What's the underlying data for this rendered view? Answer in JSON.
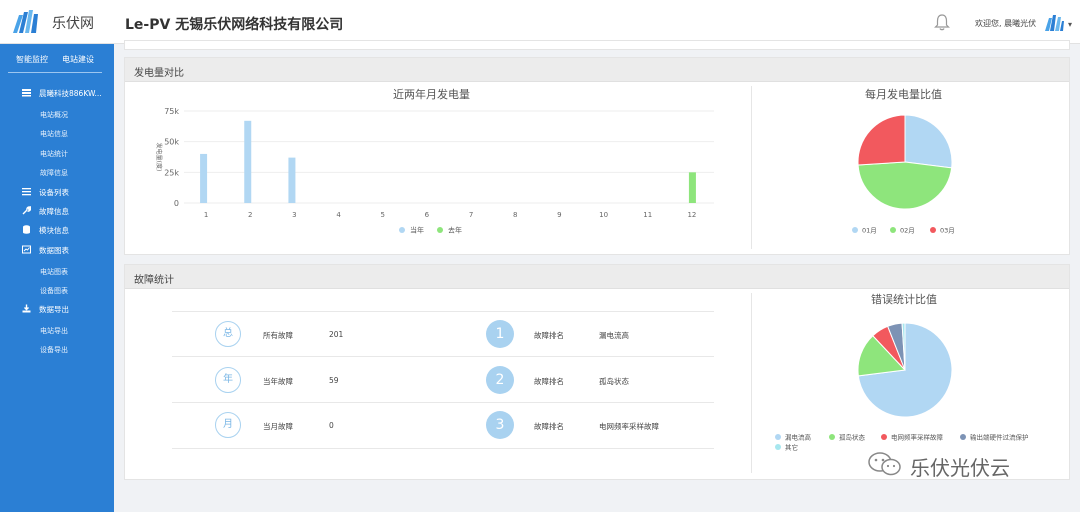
{
  "header": {
    "logo_text": "乐伏网",
    "company": "Le-PV 无锡乐伏网络科技有限公司",
    "welcome": "欢迎您, 晨曦光伏"
  },
  "sidebar": {
    "tabs": [
      "智能监控",
      "电站建设"
    ],
    "items": [
      {
        "label": "晨曦科技886KW...",
        "icon": "station-icon"
      },
      {
        "label": "电站概况"
      },
      {
        "label": "电站信息"
      },
      {
        "label": "电站统计"
      },
      {
        "label": "故障信息"
      },
      {
        "label": "设备列表",
        "icon": "list-icon"
      },
      {
        "label": "故障信息",
        "icon": "wrench-icon"
      },
      {
        "label": "模块信息",
        "icon": "database-icon"
      },
      {
        "label": "数据图表",
        "icon": "chart-icon"
      },
      {
        "label": "电站图表"
      },
      {
        "label": "设备图表"
      },
      {
        "label": "数据导出",
        "icon": "download-icon"
      },
      {
        "label": "电站导出"
      },
      {
        "label": "设备导出"
      }
    ]
  },
  "power_panel": {
    "title": "发电量对比",
    "bar_title": "近两年月发电量",
    "pie_title": "每月发电量比值"
  },
  "fault_panel": {
    "title": "故障统计",
    "pie_title": "错误统计比值",
    "rows": [
      {
        "badge": "总",
        "label": "所有故障",
        "value": "201",
        "rank": "1",
        "rank_label": "故障排名",
        "rank_value": "漏电流高"
      },
      {
        "badge": "年",
        "label": "当年故障",
        "value": "59",
        "rank": "2",
        "rank_label": "故障排名",
        "rank_value": "孤岛状态"
      },
      {
        "badge": "月",
        "label": "当月故障",
        "value": "0",
        "rank": "3",
        "rank_label": "故障排名",
        "rank_value": "电网频率采样故障"
      }
    ]
  },
  "watermark": "乐伏光伏云",
  "colors": {
    "sidebar": "#2b7fd4",
    "blue": "#b1d7f3",
    "green": "#8ee57c",
    "red": "#f2595e",
    "slate": "#7d93b5",
    "cyan": "#a7e7ef"
  },
  "chart_data": [
    {
      "type": "bar",
      "title": "近两年月发电量",
      "ylabel": "发电量(度)",
      "categories": [
        "1",
        "2",
        "3",
        "4",
        "5",
        "6",
        "7",
        "8",
        "9",
        "10",
        "11",
        "12"
      ],
      "ylim": [
        0,
        75000
      ],
      "yticks": [
        "0",
        "25k",
        "50k",
        "75k"
      ],
      "series": [
        {
          "name": "当年",
          "color": "#b1d7f3",
          "values": [
            40000,
            67000,
            37000,
            0,
            0,
            0,
            0,
            0,
            0,
            0,
            0,
            0
          ]
        },
        {
          "name": "去年",
          "color": "#8ee57c",
          "values": [
            0,
            0,
            0,
            0,
            0,
            0,
            0,
            0,
            0,
            0,
            0,
            25000
          ]
        }
      ]
    },
    {
      "type": "pie",
      "title": "每月发电量比值",
      "categories": [
        "01月",
        "02月",
        "03月"
      ],
      "values": [
        27,
        47,
        26
      ],
      "colors": [
        "#b1d7f3",
        "#8ee57c",
        "#f2595e"
      ]
    },
    {
      "type": "pie",
      "title": "错误统计比值",
      "categories": [
        "漏电流高",
        "孤岛状态",
        "电网频率采样故障",
        "输出端硬件过流保护",
        "其它"
      ],
      "values": [
        73,
        15,
        6,
        5,
        1
      ],
      "colors": [
        "#b1d7f3",
        "#8ee57c",
        "#f2595e",
        "#7d93b5",
        "#a7e7ef"
      ]
    }
  ]
}
